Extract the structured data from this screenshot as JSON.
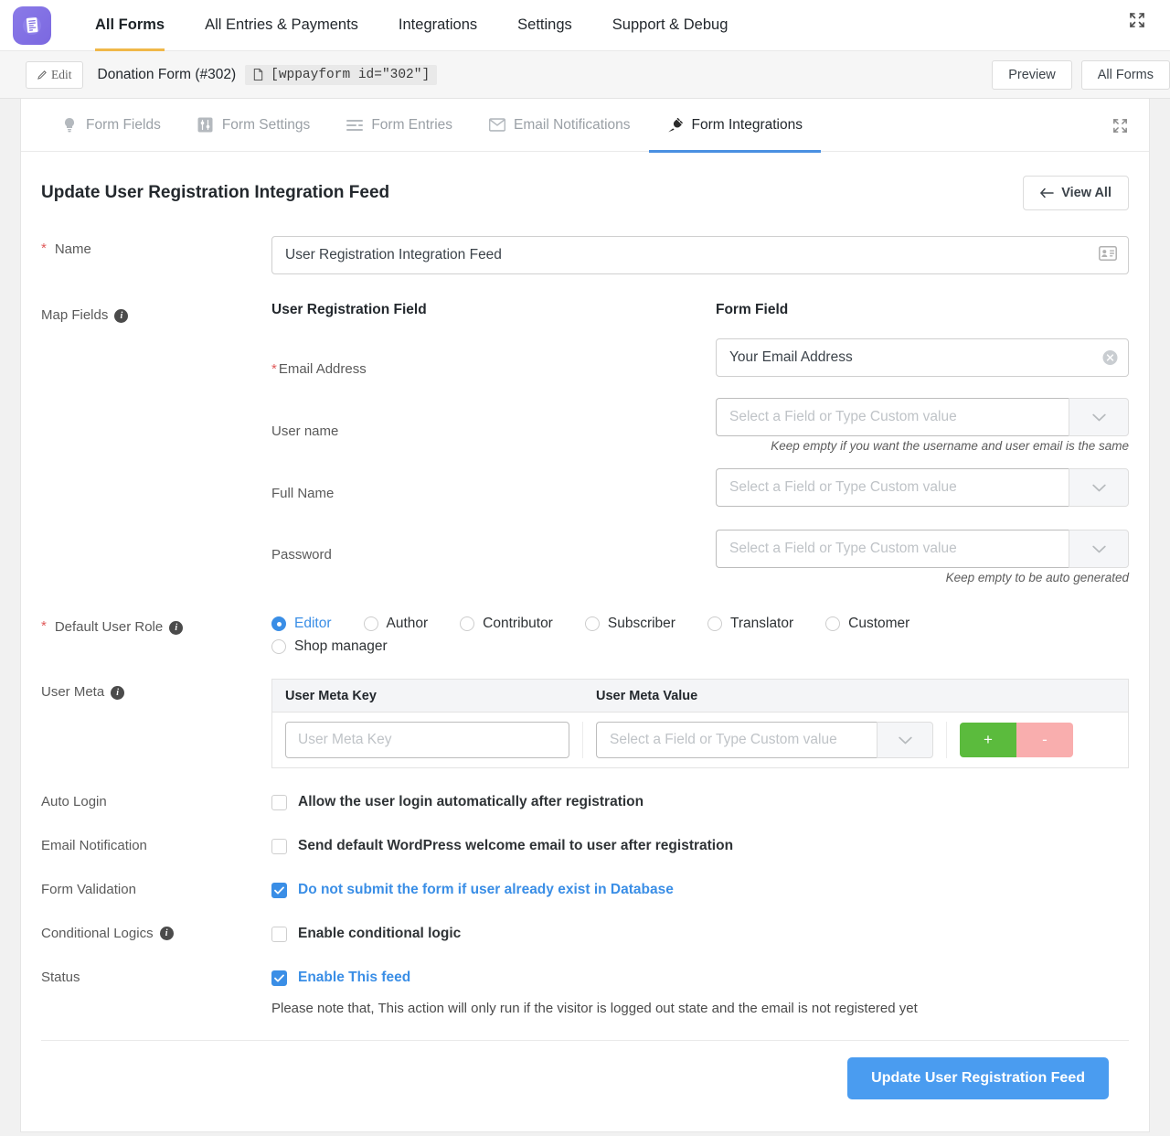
{
  "topnav": {
    "logo_icon": "form-document-logo",
    "items": [
      {
        "label": "All Forms",
        "active": true
      },
      {
        "label": "All Entries & Payments",
        "active": false
      },
      {
        "label": "Integrations",
        "active": false
      },
      {
        "label": "Settings",
        "active": false
      },
      {
        "label": "Support & Debug",
        "active": false
      }
    ],
    "expand_icon": "expand-arrows-icon"
  },
  "formbar": {
    "edit_label": "Edit",
    "edit_icon": "pencil-icon",
    "form_title": "Donation Form (#302)",
    "shortcode_icon": "copy-page-icon",
    "shortcode": "[wppayform id=\"302\"]",
    "preview_label": "Preview",
    "all_forms_label": "All Forms"
  },
  "tabs": {
    "items": [
      {
        "label": "Form Fields",
        "icon": "lightbulb-icon",
        "active": false
      },
      {
        "label": "Form Settings",
        "icon": "sliders-icon",
        "active": false
      },
      {
        "label": "Form Entries",
        "icon": "list-lines-icon",
        "active": false
      },
      {
        "label": "Email Notifications",
        "icon": "envelope-icon",
        "active": false
      },
      {
        "label": "Form Integrations",
        "icon": "plug-icon",
        "active": true
      }
    ],
    "expand_icon": "expand-arrows-icon"
  },
  "page": {
    "title": "Update User Registration Integration Feed",
    "view_all_label": "View All",
    "view_all_icon": "arrow-left-icon"
  },
  "name_field": {
    "label": "Name",
    "required": true,
    "value": "User Registration Integration Feed",
    "icon": "address-card-icon"
  },
  "map_fields": {
    "label": "Map Fields",
    "info_icon": "info-icon",
    "col_left_header": "User Registration Field",
    "col_right_header": "Form Field",
    "select_placeholder": "Select a Field or Type Custom value",
    "dropdown_icon": "chevron-down-icon",
    "clear_icon": "clear-circle-icon",
    "rows": [
      {
        "name": "Email Address",
        "required": true,
        "value": "Your Email Address",
        "type": "filled",
        "hint": ""
      },
      {
        "name": "User name",
        "required": false,
        "value": "",
        "type": "select",
        "hint": "Keep empty if you want the username and user email is the same"
      },
      {
        "name": "Full Name",
        "required": false,
        "value": "",
        "type": "select",
        "hint": ""
      },
      {
        "name": "Password",
        "required": false,
        "value": "",
        "type": "select",
        "hint": "Keep empty to be auto generated"
      }
    ]
  },
  "user_role": {
    "label": "Default User Role",
    "required": true,
    "info_icon": "info-icon",
    "options": [
      {
        "label": "Editor",
        "selected": true
      },
      {
        "label": "Author",
        "selected": false
      },
      {
        "label": "Contributor",
        "selected": false
      },
      {
        "label": "Subscriber",
        "selected": false
      },
      {
        "label": "Translator",
        "selected": false
      },
      {
        "label": "Customer",
        "selected": false
      },
      {
        "label": "Shop manager",
        "selected": false
      }
    ]
  },
  "user_meta": {
    "label": "User Meta",
    "info_icon": "info-icon",
    "col_key": "User Meta Key",
    "col_value": "User Meta Value",
    "key_placeholder": "User Meta Key",
    "value_placeholder": "Select a Field or Type Custom value",
    "dropdown_icon": "chevron-down-icon",
    "add_label": "+",
    "remove_label": "-"
  },
  "toggles": [
    {
      "label": "Auto Login",
      "info": false,
      "text": "Allow the user login automatically after registration",
      "checked": false
    },
    {
      "label": "Email Notification",
      "info": false,
      "text": "Send default WordPress welcome email to user after registration",
      "checked": false
    },
    {
      "label": "Form Validation",
      "info": false,
      "text": "Do not submit the form if user already exist in Database",
      "checked": true
    },
    {
      "label": "Conditional Logics",
      "info": true,
      "text": "Enable conditional logic",
      "checked": false
    },
    {
      "label": "Status",
      "info": false,
      "text": "Enable This feed",
      "checked": true
    }
  ],
  "note": "Please note that, This action will only run if the visitor is logged out state and the email is not registered yet",
  "submit": {
    "label": "Update User Registration Feed"
  },
  "colors": {
    "accent_blue": "#3a8ee6",
    "primary_button": "#4a9cf0",
    "logo_purple": "#7b68e0",
    "active_tab_underline": "#4a90e2",
    "topnav_underline": "#f0b849",
    "required_red": "#e05a5a",
    "add_green": "#5bbb3d",
    "remove_pink": "#f9aeae"
  }
}
